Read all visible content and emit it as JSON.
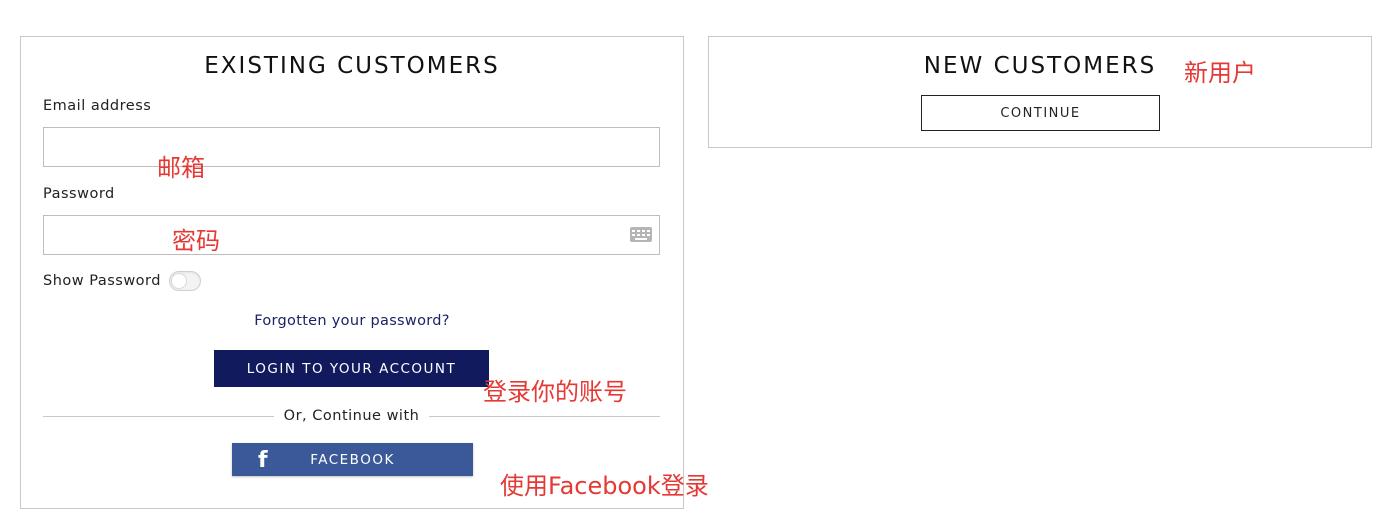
{
  "existing": {
    "title": "EXISTING CUSTOMERS",
    "email_label": "Email address",
    "email_value": "",
    "password_label": "Password",
    "password_value": "",
    "show_password_label": "Show Password",
    "forgot_link": "Forgotten your password?",
    "login_button": "LOGIN TO YOUR ACCOUNT",
    "divider_text": "Or, Continue with",
    "facebook_button": "FACEBOOK",
    "facebook_icon": "facebook-f-icon"
  },
  "new_customers": {
    "title": "NEW CUSTOMERS",
    "continue_button": "CONTINUE"
  },
  "annotations": {
    "email": "邮箱",
    "password": "密码",
    "login": "登录你的账号",
    "facebook": "使用Facebook登录",
    "new_user": "新用户"
  },
  "colors": {
    "login_button_bg": "#121a5e",
    "facebook_bg": "#3b5998",
    "annotation": "#e53935",
    "link": "#1a2366"
  }
}
